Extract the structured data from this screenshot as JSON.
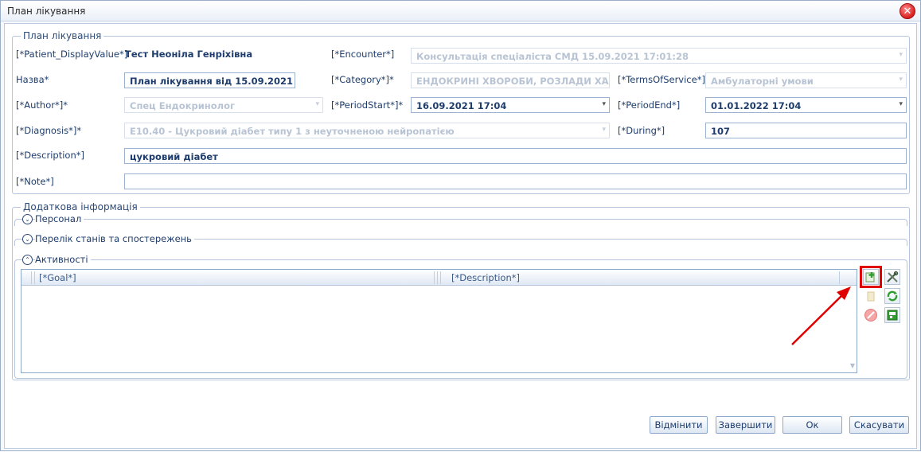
{
  "window": {
    "title": "План лікування"
  },
  "group_main": {
    "legend": "План лікування"
  },
  "fields": {
    "patient_label": "[*Patient_DisplayValue*]",
    "patient_value": "Тест Неоніла Генріхівна",
    "encounter_label": "[*Encounter*]",
    "encounter_value": "Консультація спеціаліста СМД 15.09.2021 17:01:28",
    "name_label": "Назва*",
    "name_value": "План лікування від 15.09.2021",
    "category_label": "[*Category*]*",
    "category_value": "ЕНДОКРИНІ ХВОРОБИ, РОЗЛАДИ ХАР",
    "terms_label": "[*TermsOfService*]*",
    "terms_value": "Амбулаторні умови",
    "author_label": "[*Author*]*",
    "author_value": "Спец Ендокринолог",
    "period_start_label": "[*PeriodStart*]*",
    "period_start_value": "16.09.2021 17:04",
    "period_end_label": "[*PeriodEnd*]",
    "period_end_value": "01.01.2022 17:04",
    "diagnosis_label": "[*Diagnosis*]*",
    "diagnosis_value": "E10.40 - Цукровий діабет типу 1 з неуточненою нейропатією",
    "during_label": "[*During*]",
    "during_value": "107",
    "description_label": "[*Description*]",
    "description_value": "цукровий діабет",
    "note_label": "[*Note*]",
    "note_value": ""
  },
  "additional": {
    "legend": "Додаткова інформація",
    "personnel": "Персонал",
    "conditions": "Перелік станів та спостережень",
    "activities": "Активності"
  },
  "grid": {
    "col_goal": "[*Goal*]",
    "col_description": "[*Description*]"
  },
  "buttons": {
    "undo": "Відмінити",
    "finish": "Завершити",
    "ok": "Ок",
    "cancel": "Скасувати"
  },
  "colors": {
    "highlight": "#e00000",
    "accent": "#1e3d6e"
  }
}
